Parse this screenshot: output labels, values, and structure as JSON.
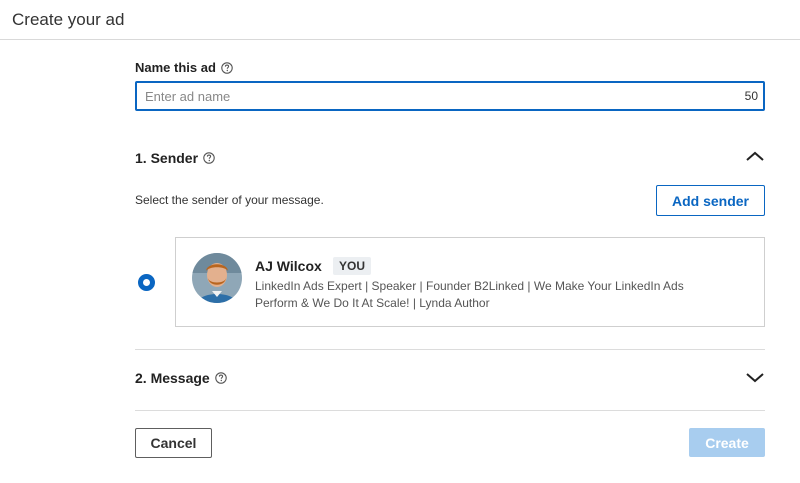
{
  "header": {
    "title": "Create your ad"
  },
  "name_field": {
    "label": "Name this ad",
    "placeholder": "Enter ad name",
    "value": "",
    "char_limit": "50"
  },
  "sender_section": {
    "title": "1.  Sender",
    "description": "Select the sender of your message.",
    "add_sender_label": "Add sender",
    "expanded": true,
    "sender": {
      "name": "AJ Wilcox",
      "badge": "YOU",
      "headline": "LinkedIn Ads Expert | Speaker | Founder B2Linked | We Make Your LinkedIn Ads Perform & We Do It At Scale! | Lynda Author",
      "selected": true
    }
  },
  "message_section": {
    "title": "2.  Message",
    "expanded": false
  },
  "footer": {
    "cancel_label": "Cancel",
    "create_label": "Create"
  },
  "colors": {
    "accent": "#0a66c2",
    "create_disabled": "#a8cdef"
  },
  "icons": {
    "help": "help-circle-icon",
    "collapse": "chevron-up-icon",
    "expand": "chevron-down-icon"
  }
}
